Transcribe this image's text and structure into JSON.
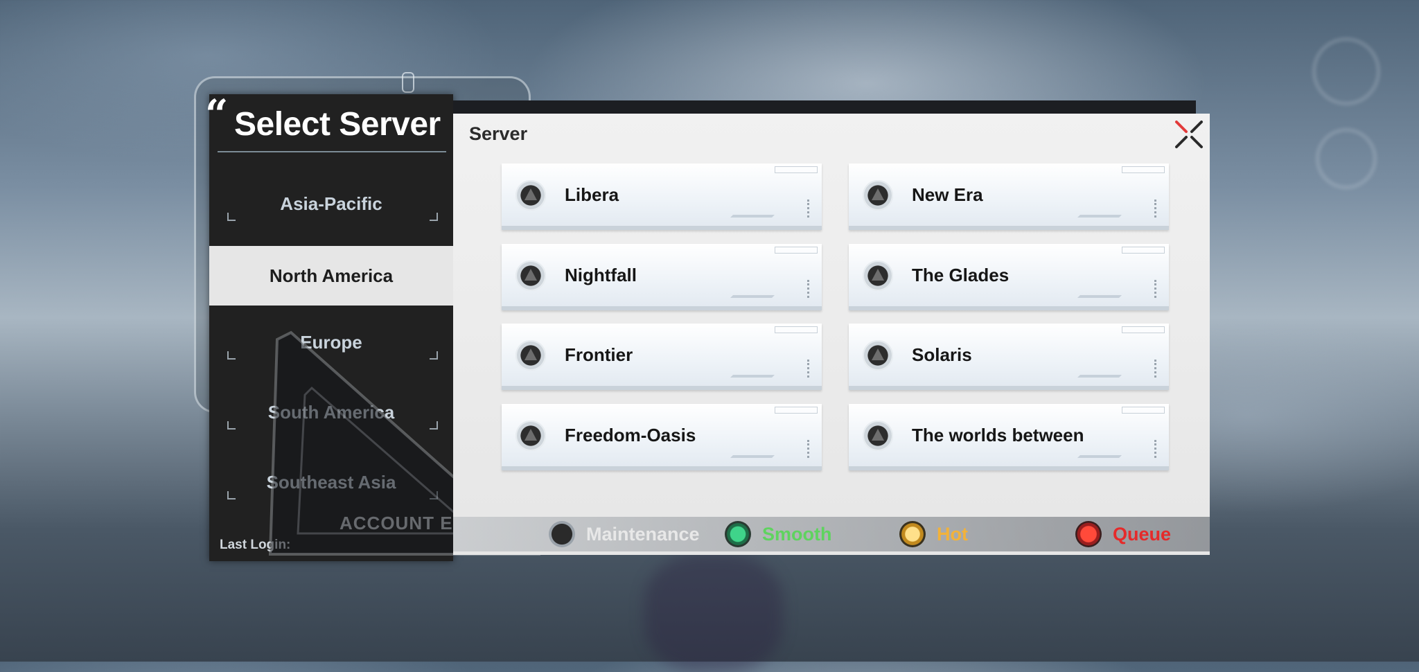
{
  "header": {
    "title": "Select Server",
    "quote": "“"
  },
  "regions": [
    {
      "label": "Asia-Pacific",
      "active": false
    },
    {
      "label": "North America",
      "active": true
    },
    {
      "label": "Europe",
      "active": false
    },
    {
      "label": "South America",
      "active": false
    },
    {
      "label": "Southeast Asia",
      "active": false
    }
  ],
  "last_login": {
    "label": "Last Login:"
  },
  "decor": {
    "account_entry": "ACCOUNT ENTRY"
  },
  "server_panel": {
    "title": "Server",
    "close_icon": "close-icon",
    "servers": [
      {
        "name": "Libera",
        "status": "maintenance"
      },
      {
        "name": "New Era",
        "status": "maintenance"
      },
      {
        "name": "Nightfall",
        "status": "maintenance"
      },
      {
        "name": "The Glades",
        "status": "maintenance"
      },
      {
        "name": "Frontier",
        "status": "maintenance"
      },
      {
        "name": "Solaris",
        "status": "maintenance"
      },
      {
        "name": "Freedom-Oasis",
        "status": "maintenance"
      },
      {
        "name": "The worlds between",
        "status": "maintenance"
      }
    ]
  },
  "legend": [
    {
      "label": "Maintenance",
      "color": "#e8e8e8",
      "icon_color": "#2a2a2a"
    },
    {
      "label": "Smooth",
      "color": "#5fd35f",
      "icon_color": "#2fbf6a"
    },
    {
      "label": "Hot",
      "color": "#f2b23a",
      "icon_color": "#f2c14a"
    },
    {
      "label": "Queue",
      "color": "#e52a2a",
      "icon_color": "#e02a2a"
    }
  ],
  "colors": {
    "panel_dark": "#212121",
    "panel_light": "#eeeeee",
    "active_region_bg": "#e6e6e6"
  }
}
